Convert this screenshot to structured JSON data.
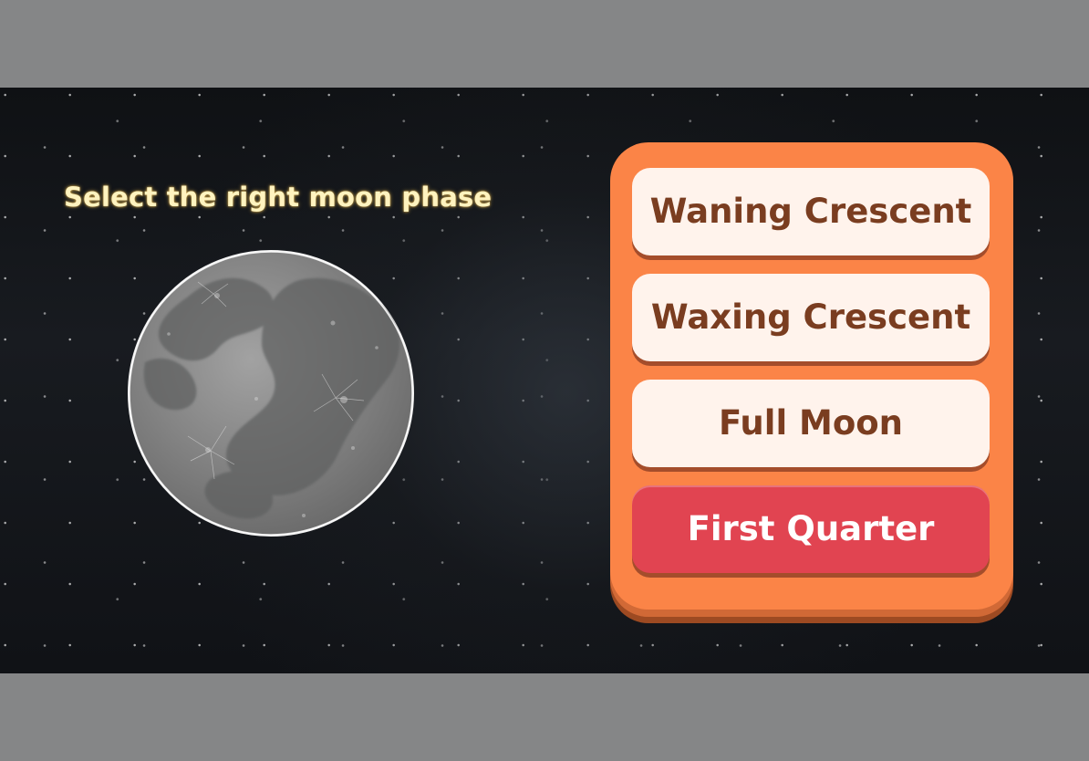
{
  "game": {
    "prompt": "Select the right moon phase",
    "moon_phase_shown": "full",
    "options": [
      {
        "label": "Waning Crescent",
        "selected": false
      },
      {
        "label": "Waxing Crescent",
        "selected": false
      },
      {
        "label": "Full Moon",
        "selected": false
      },
      {
        "label": "First Quarter",
        "selected": true
      }
    ]
  },
  "colors": {
    "panel": "#fb8447",
    "option_background": "#fff3ec",
    "option_text": "#7a3d20",
    "selected_option": "#e14451",
    "prompt_text": "#fff3bf"
  },
  "icons": {
    "moon": "full-moon-icon"
  }
}
